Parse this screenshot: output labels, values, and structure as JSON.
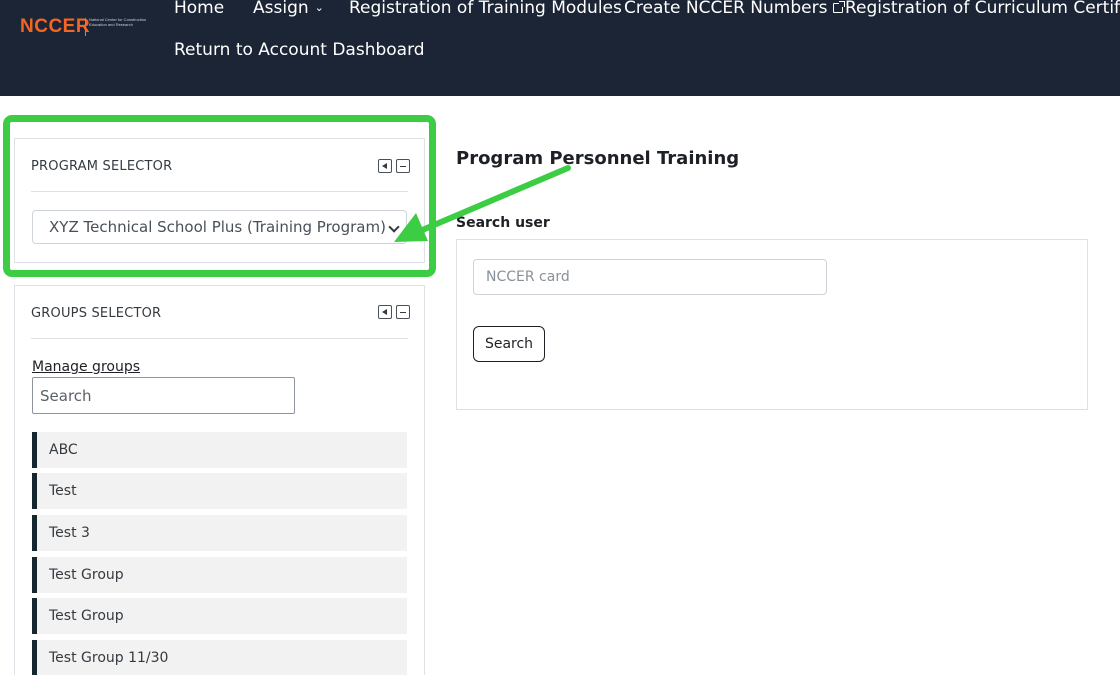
{
  "nav": {
    "logo_text": "NCCER",
    "logo_tagline": "National Center for Construction Education and Research",
    "items": [
      {
        "label": "Home"
      },
      {
        "label": "Assign"
      },
      {
        "label": "Registration of Training Modules"
      },
      {
        "label": "Create NCCER Numbers"
      },
      {
        "label": "Registration of Curriculum Certificatio"
      },
      {
        "label": "Return to Account Dashboard"
      }
    ]
  },
  "program_selector": {
    "title": "PROGRAM SELECTOR",
    "selected": "XYZ Technical School Plus (Training Program)"
  },
  "groups_selector": {
    "title": "GROUPS SELECTOR",
    "manage_link": "Manage groups",
    "search_placeholder": "Search",
    "items": [
      {
        "label": "ABC"
      },
      {
        "label": "Test"
      },
      {
        "label": "Test 3"
      },
      {
        "label": "Test Group"
      },
      {
        "label": "Test Group"
      },
      {
        "label": "Test Group 11/30"
      }
    ]
  },
  "main": {
    "title": "Program Personnel Training",
    "search_label": "Search user",
    "search_placeholder": "NCCER card",
    "search_button": "Search"
  },
  "colors": {
    "nav_bg": "#1c2536",
    "brand_orange": "#f26522",
    "annotation_green": "#3ccd45",
    "group_accent": "#14262e"
  }
}
